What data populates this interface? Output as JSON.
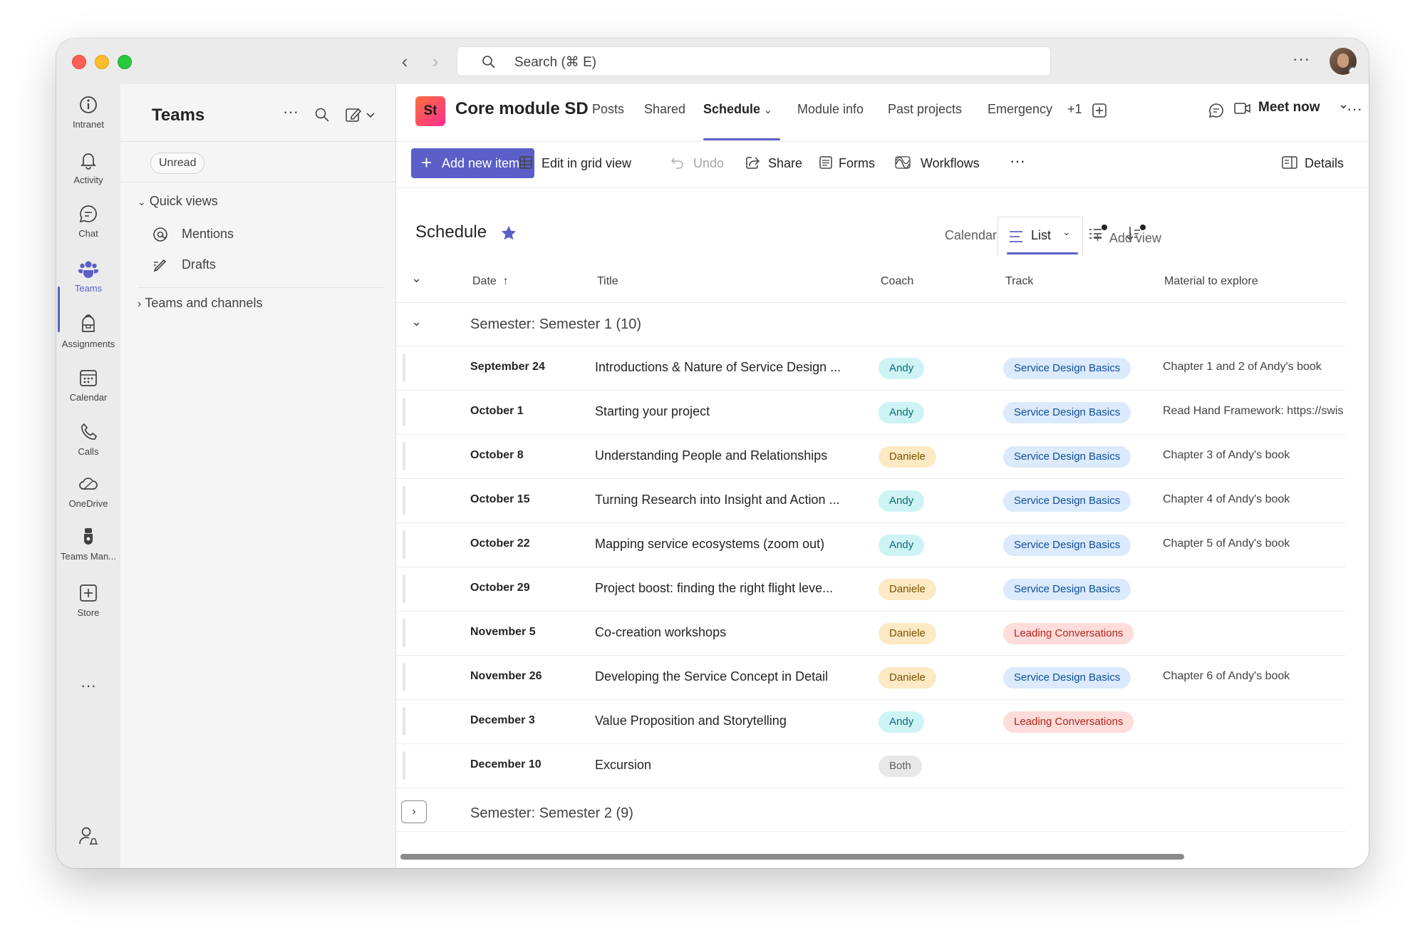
{
  "window": {
    "search_placeholder": "Search (⌘ E)",
    "more": "···"
  },
  "rail": [
    {
      "name": "rail-intranet",
      "icon": "info-icon",
      "label": "Intranet"
    },
    {
      "name": "rail-activity",
      "icon": "bell-icon",
      "label": "Activity"
    },
    {
      "name": "rail-chat",
      "icon": "chat-icon",
      "label": "Chat"
    },
    {
      "name": "rail-teams",
      "icon": "teams-icon",
      "label": "Teams",
      "active": true
    },
    {
      "name": "rail-assignments",
      "icon": "backpack-icon",
      "label": "Assignments"
    },
    {
      "name": "rail-calendar",
      "icon": "calendar-icon",
      "label": "Calendar"
    },
    {
      "name": "rail-calls",
      "icon": "phone-icon",
      "label": "Calls"
    },
    {
      "name": "rail-onedrive",
      "icon": "cloud-icon",
      "label": "OneDrive"
    },
    {
      "name": "rail-teams-manager",
      "icon": "teams-manager-icon",
      "label": "Teams Man..."
    },
    {
      "name": "rail-store",
      "icon": "plus-square-icon",
      "label": "Store"
    }
  ],
  "rail_more": "···",
  "pane": {
    "title": "Teams",
    "more": "···",
    "filter_chip": "Unread",
    "quick_views": "Quick views",
    "mentions": "Mentions",
    "drafts": "Drafts",
    "teams_and_channels": "Teams and channels"
  },
  "header": {
    "avatar_initials": "St",
    "channel_title": "Core module SD",
    "tabs": [
      "Posts",
      "Shared",
      "Schedule",
      "Module info",
      "Past projects",
      "Emergency"
    ],
    "active_tab": "Schedule",
    "overflow_count": "+1",
    "meet_now": "Meet now",
    "more": "···"
  },
  "toolbar": {
    "add_new_item": "Add new item",
    "edit_grid": "Edit in grid view",
    "undo": "Undo",
    "share": "Share",
    "forms": "Forms",
    "workflows": "Workflows",
    "more": "···",
    "details": "Details"
  },
  "list": {
    "title": "Schedule",
    "calendar_view": "Calendar",
    "list_view": "List",
    "add_view": "Add view",
    "columns": [
      "Date",
      "Title",
      "Coach",
      "Track",
      "Material to explore"
    ],
    "group1": "Semester: Semester 1 (10)",
    "group2": "Semester: Semester 2 (9)",
    "rows": [
      {
        "date": "September 24",
        "title": "Introductions & Nature of Service Design ...",
        "coach": "Andy",
        "track": "Service Design Basics",
        "material": "Chapter 1 and 2 of Andy's book"
      },
      {
        "date": "October 1",
        "title": "Starting your project",
        "coach": "Andy",
        "track": "Service Design Basics",
        "material": "Read Hand Framework: https://swis"
      },
      {
        "date": "October 8",
        "title": "Understanding People and Relationships",
        "coach": "Daniele",
        "track": "Service Design Basics",
        "material": "Chapter 3 of Andy's book"
      },
      {
        "date": "October 15",
        "title": "Turning Research into Insight and Action ...",
        "coach": "Andy",
        "track": "Service Design Basics",
        "material": "Chapter 4 of Andy's book"
      },
      {
        "date": "October 22",
        "title": "Mapping service ecosystems (zoom out)",
        "coach": "Andy",
        "track": "Service Design Basics",
        "material": "Chapter 5 of Andy's book"
      },
      {
        "date": "October 29",
        "title": "Project boost: finding the right flight leve...",
        "coach": "Daniele",
        "track": "Service Design Basics",
        "material": ""
      },
      {
        "date": "November 5",
        "title": "Co-creation workshops",
        "coach": "Daniele",
        "track": "Leading Conversations",
        "material": ""
      },
      {
        "date": "November 26",
        "title": "Developing the Service Concept in Detail",
        "coach": "Daniele",
        "track": "Service Design Basics",
        "material": "Chapter 6 of Andy's book"
      },
      {
        "date": "December 3",
        "title": "Value Proposition and Storytelling",
        "coach": "Andy",
        "track": "Leading Conversations",
        "material": ""
      },
      {
        "date": "December 10",
        "title": "Excursion",
        "coach": "Both",
        "track": "",
        "material": ""
      }
    ]
  },
  "colors": {
    "accent": "#5b5fc7",
    "pill_andy_bg": "#cdf3f5",
    "pill_andy_fg": "#0e6b74",
    "pill_daniele_bg": "#fde9c4",
    "pill_daniele_fg": "#7a5200",
    "pill_both_bg": "#e8e8e8",
    "pill_both_fg": "#616161",
    "pill_sdb_bg": "#dbeafc",
    "pill_sdb_fg": "#0f4f9a",
    "pill_lc_bg": "#fddcd9",
    "pill_lc_fg": "#b3261e"
  }
}
